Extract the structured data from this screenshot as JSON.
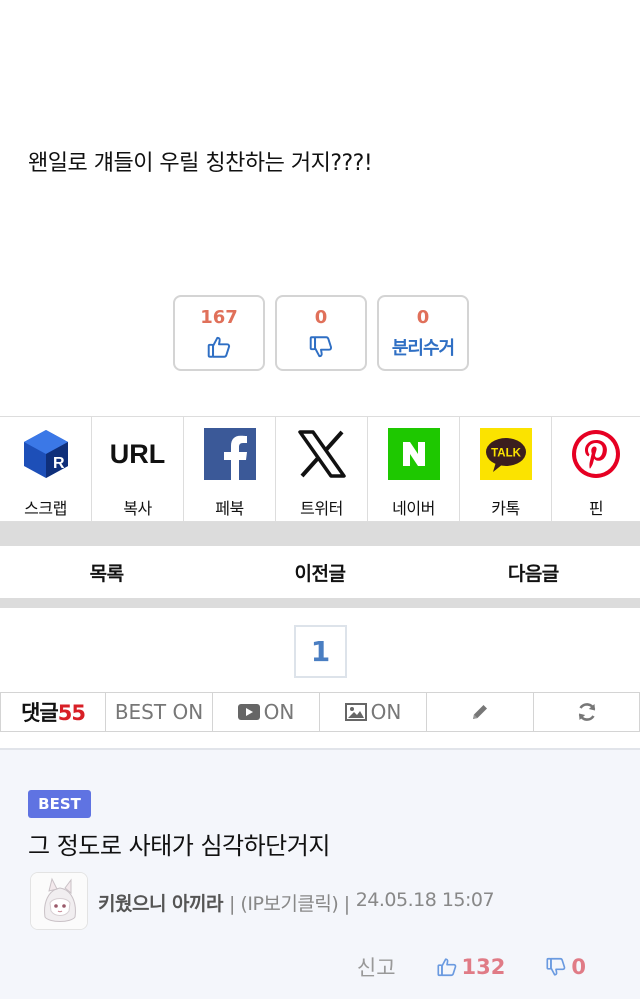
{
  "post": {
    "body": "왠일로 걔들이 우릴 칭찬하는 거지???!"
  },
  "votes": {
    "up_count": "167",
    "down_count": "0",
    "recycle_count": "0",
    "recycle_label": "분리수거"
  },
  "share": [
    {
      "icon": "scrap-cube-icon",
      "label": "스크랩"
    },
    {
      "icon": "url-text-icon",
      "text": "URL",
      "label": "복사"
    },
    {
      "icon": "facebook-icon",
      "label": "페북"
    },
    {
      "icon": "x-twitter-icon",
      "label": "트위터"
    },
    {
      "icon": "naver-icon",
      "label": "네이버"
    },
    {
      "icon": "kakaotalk-icon",
      "text": "TALK",
      "label": "카톡"
    },
    {
      "icon": "pinterest-icon",
      "label": "핀"
    }
  ],
  "nav": {
    "list": "목록",
    "prev": "이전글",
    "next": "다음글"
  },
  "pager": {
    "current": "1"
  },
  "comment_bar": {
    "label": "댓글",
    "count": "55",
    "best": "BEST ON",
    "video": "ON",
    "image": "ON"
  },
  "comment": {
    "badge": "BEST",
    "text": "그 정도로 사태가 심각하단거지",
    "nick": "키웠으니 아끼라",
    "ip": "| (IP보기클릭) |",
    "date": "24.05.18 15:07",
    "report": "신고",
    "up": "132",
    "down": "0"
  },
  "colors": {
    "up_red": "#e0705a",
    "blue_label": "#2f6fc4",
    "best_badge": "#5f73e2",
    "comment_bg": "#f4f6fb",
    "band_grey": "#dcdcdc"
  }
}
